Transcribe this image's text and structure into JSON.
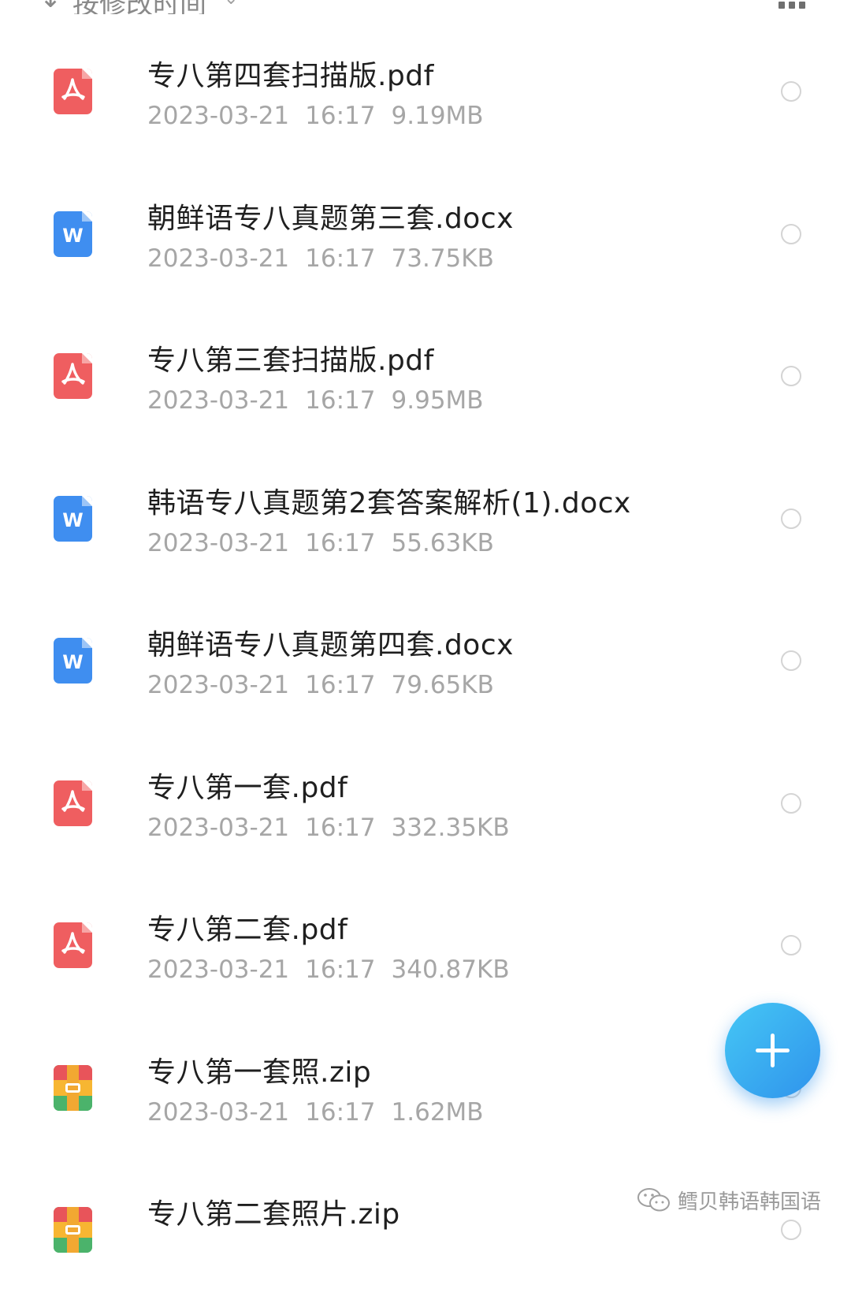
{
  "sort_bar": {
    "arrow_icon": "sort-arrow-icon",
    "label": "按修改时间",
    "chevron_icon": "chevron-down-icon",
    "view_toggle_icon": "grid-view-icon"
  },
  "files": [
    {
      "name": "专八第四套扫描版.pdf",
      "date": "2023-03-21",
      "time": "16:17",
      "size": "9.19MB",
      "type": "pdf"
    },
    {
      "name": "朝鲜语专八真题第三套.docx",
      "date": "2023-03-21",
      "time": "16:17",
      "size": "73.75KB",
      "type": "doc"
    },
    {
      "name": "专八第三套扫描版.pdf",
      "date": "2023-03-21",
      "time": "16:17",
      "size": "9.95MB",
      "type": "pdf"
    },
    {
      "name": "韩语专八真题第2套答案解析(1).docx",
      "date": "2023-03-21",
      "time": "16:17",
      "size": "55.63KB",
      "type": "doc"
    },
    {
      "name": "朝鲜语专八真题第四套.docx",
      "date": "2023-03-21",
      "time": "16:17",
      "size": "79.65KB",
      "type": "doc"
    },
    {
      "name": "专八第一套.pdf",
      "date": "2023-03-21",
      "time": "16:17",
      "size": "332.35KB",
      "type": "pdf"
    },
    {
      "name": "专八第二套.pdf",
      "date": "2023-03-21",
      "time": "16:17",
      "size": "340.87KB",
      "type": "pdf"
    },
    {
      "name": "专八第一套照.zip",
      "date": "2023-03-21",
      "time": "16:17",
      "size": "1.62MB",
      "type": "zip"
    },
    {
      "name": "专八第二套照片.zip",
      "date": "",
      "time": "",
      "size": "",
      "type": "zip"
    }
  ],
  "icons": {
    "pdf": "pdf-file-icon",
    "doc": "word-file-icon",
    "zip": "archive-file-icon",
    "word_letter": "W"
  },
  "fab_icon": "plus-icon",
  "watermark": {
    "icon": "wechat-icon",
    "text": "鳕贝韩语韩国语"
  },
  "colors": {
    "pdf": "#ef5e60",
    "doc": "#3f8ef0",
    "fab": "#3aa8f0",
    "meta_text": "#a6a6a6"
  }
}
